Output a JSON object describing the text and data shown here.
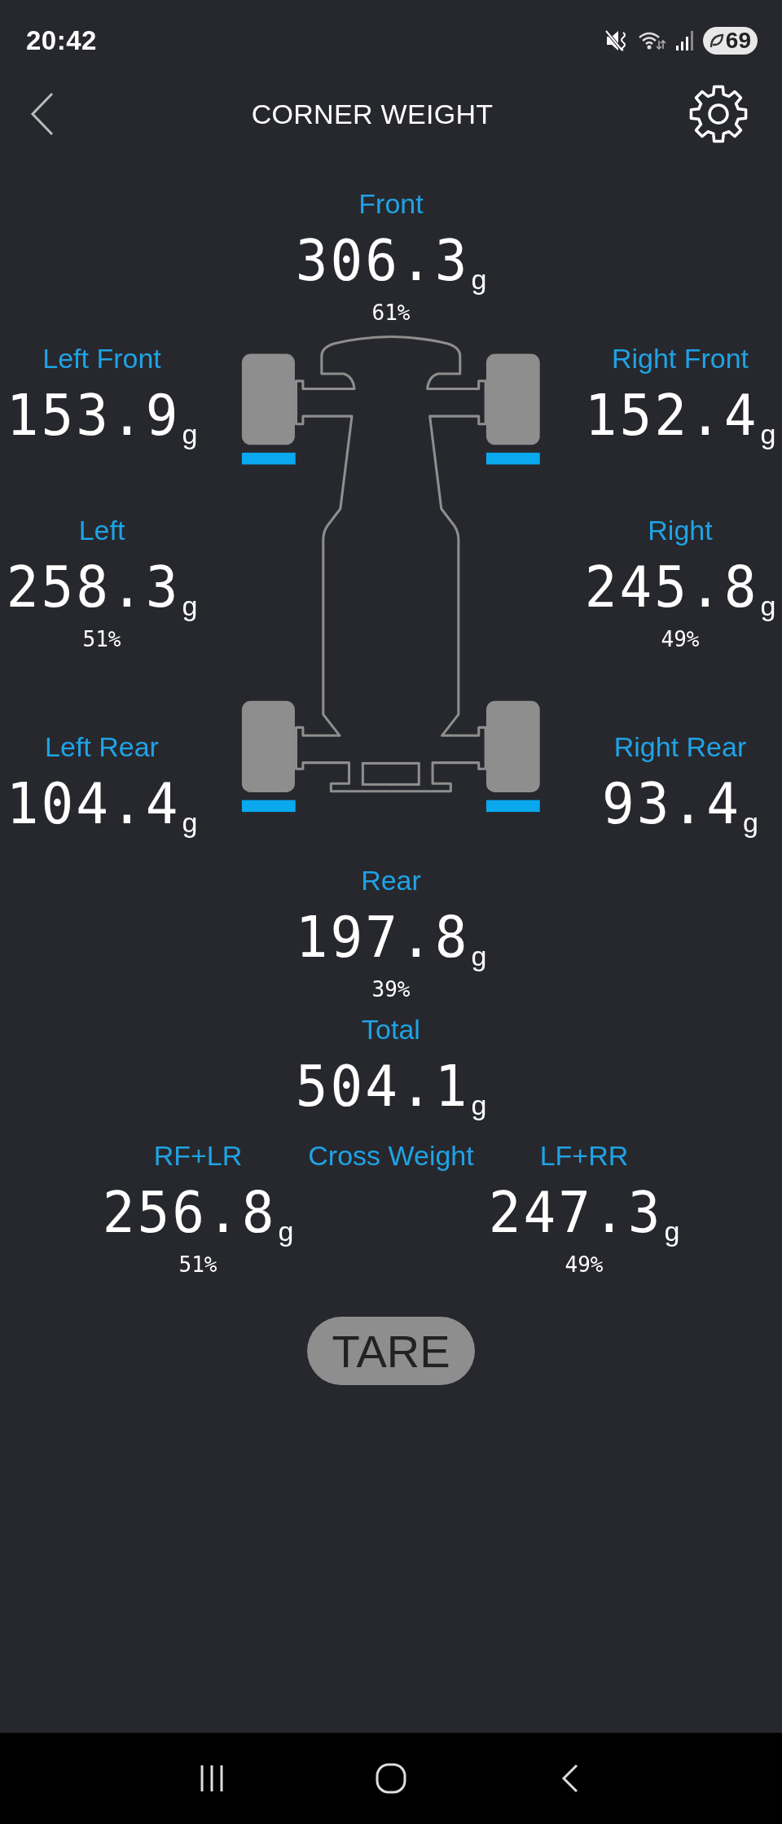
{
  "status_bar": {
    "time": "20:42",
    "battery": "69"
  },
  "header": {
    "title": "CORNER WEIGHT"
  },
  "front": {
    "label": "Front",
    "value": "306.3",
    "unit": "g",
    "percent": "61%"
  },
  "left_front": {
    "label": "Left Front",
    "value": "153.9",
    "unit": "g"
  },
  "right_front": {
    "label": "Right Front",
    "value": "152.4",
    "unit": "g"
  },
  "left": {
    "label": "Left",
    "value": "258.3",
    "unit": "g",
    "percent": "51%"
  },
  "right": {
    "label": "Right",
    "value": "245.8",
    "unit": "g",
    "percent": "49%"
  },
  "left_rear": {
    "label": "Left Rear",
    "value": "104.4",
    "unit": "g"
  },
  "right_rear": {
    "label": "Right Rear",
    "value": "93.4",
    "unit": "g"
  },
  "rear": {
    "label": "Rear",
    "value": "197.8",
    "unit": "g",
    "percent": "39%"
  },
  "total": {
    "label": "Total",
    "value": "504.1",
    "unit": "g"
  },
  "cross_weight": {
    "label": "Cross Weight",
    "rf_lr": {
      "label": "RF+LR",
      "value": "256.8",
      "unit": "g",
      "percent": "51%"
    },
    "lf_rr": {
      "label": "LF+RR",
      "value": "247.3",
      "unit": "g",
      "percent": "49%"
    }
  },
  "tare_button": {
    "label": "TARE"
  }
}
